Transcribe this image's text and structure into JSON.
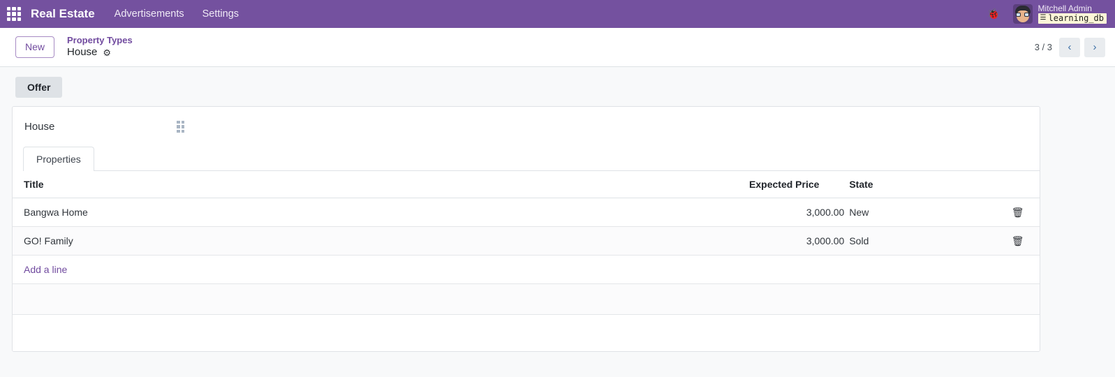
{
  "navbar": {
    "apps_icon": "apps-grid-icon",
    "brand": "Real Estate",
    "menu_items": [
      {
        "label": "Advertisements"
      },
      {
        "label": "Settings"
      }
    ],
    "bug_icon": "bug-icon",
    "bug_glyph": "🐞",
    "user": {
      "name": "Mitchell Admin",
      "database": "learning_db",
      "db_icon_glyph": "☰"
    },
    "background_color": "#74519f"
  },
  "control_panel": {
    "new_button": "New",
    "breadcrumb": {
      "parent": "Property Types",
      "current": "House",
      "gear_icon": "gear-icon",
      "gear_glyph": "⚙"
    },
    "pager": {
      "count": "3 / 3",
      "prev_glyph": "‹",
      "next_glyph": "›"
    }
  },
  "stat_buttons": [
    {
      "label": "Offer"
    }
  ],
  "sheet": {
    "record_title": "House",
    "drag_handle_icon": "drag-handle-icon",
    "tabs": [
      {
        "label": "Properties",
        "active": true
      }
    ],
    "properties_table": {
      "columns": [
        "Title",
        "Expected Price",
        "State"
      ],
      "rows": [
        {
          "title": "Bangwa Home",
          "expected_price": "3,000.00",
          "state": "New",
          "delete_glyph": "🗑"
        },
        {
          "title": "GO! Family",
          "expected_price": "3,000.00",
          "state": "Sold",
          "delete_glyph": "🗑"
        }
      ],
      "add_line_label": "Add a line"
    }
  },
  "colors": {
    "brand_purple": "#714b9f",
    "navbar_purple": "#74519f",
    "page_background": "#f8f9fa",
    "sheet_background": "#ffffff",
    "link_purple": "#714b9f"
  }
}
